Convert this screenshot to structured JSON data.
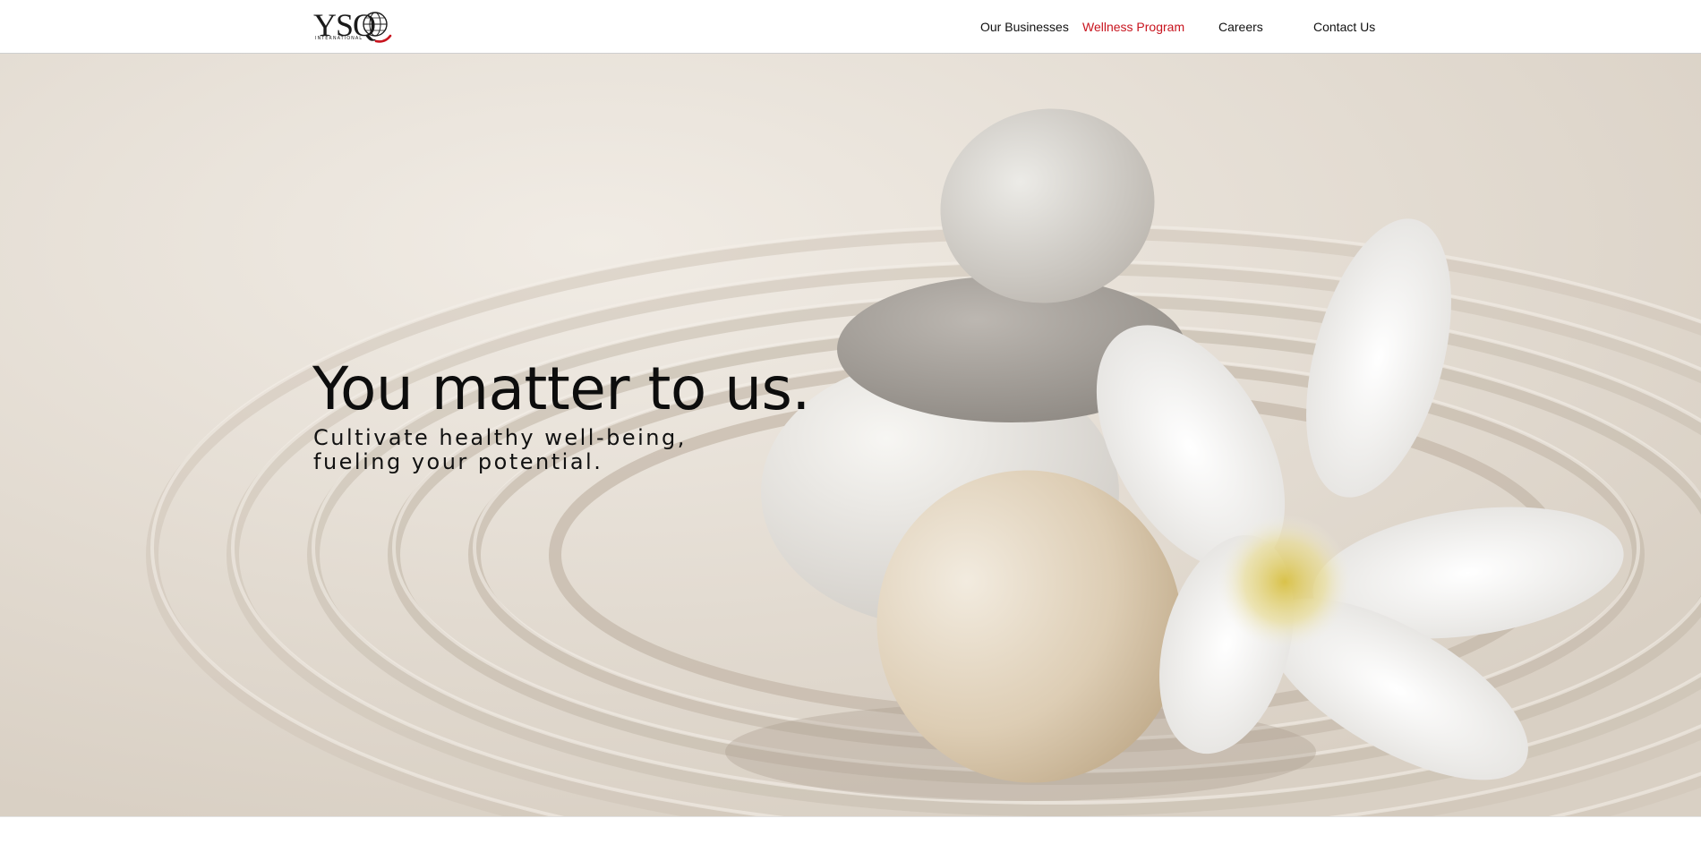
{
  "header": {
    "logo": {
      "text": "YSQ",
      "subtext": "INTERNATIONAL",
      "icon": "globe-icon"
    },
    "nav": [
      {
        "label": "Our Businesses",
        "active": false
      },
      {
        "label": "Wellness Program",
        "active": true
      },
      {
        "label": "Careers",
        "active": false
      },
      {
        "label": "Contact Us",
        "active": false
      }
    ]
  },
  "hero": {
    "headline": "You matter to us.",
    "subline": [
      "Cultivate healthy well-being,",
      "fueling your potential."
    ],
    "image": "zen stones stacked on raked sand with a white plumeria flower"
  },
  "colors": {
    "accent": "#c8141e",
    "text": "#111111",
    "sand": "#e6dfd6"
  }
}
